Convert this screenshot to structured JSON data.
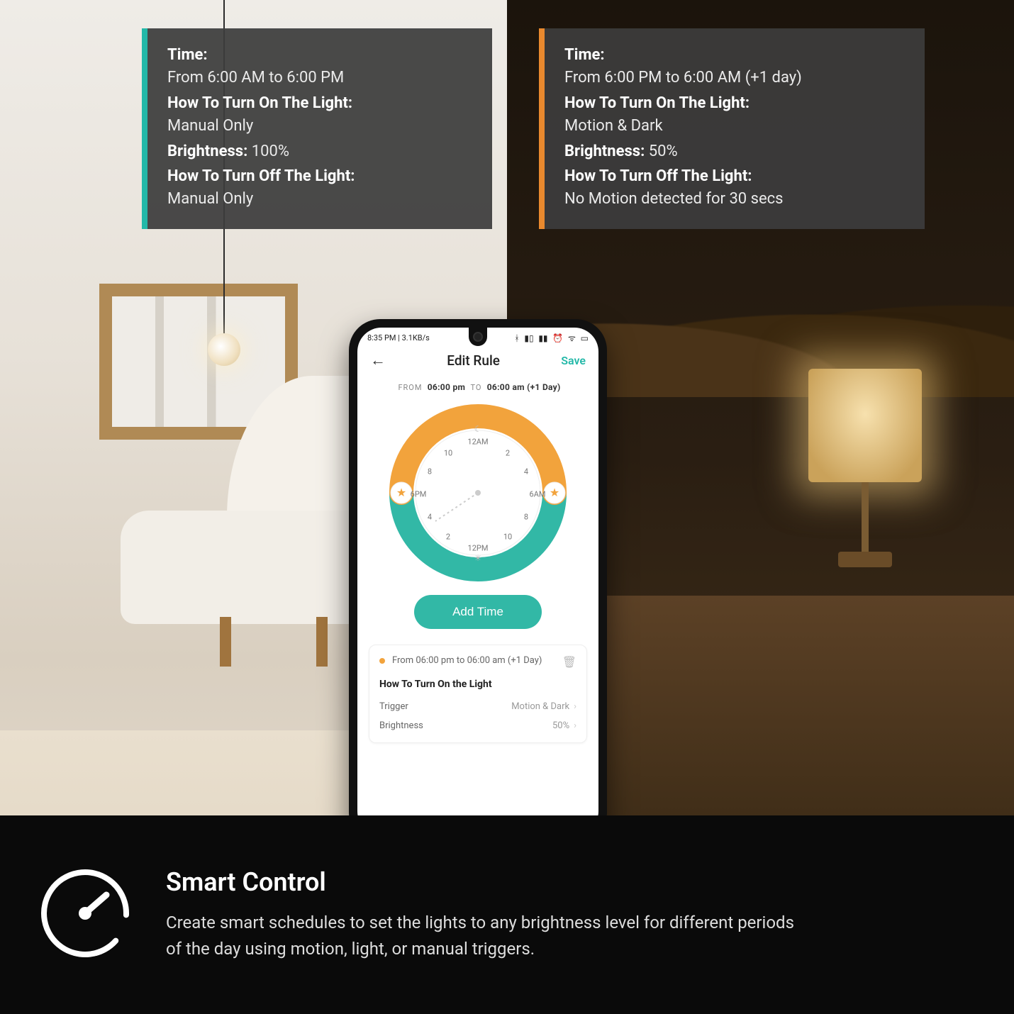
{
  "colors": {
    "teal": "#23b8a8",
    "orange": "#e9892e",
    "accent_btn": "#32b8a6"
  },
  "cards": {
    "left": {
      "time_label": "Time:",
      "time_value": "From 6:00 AM to 6:00 PM",
      "on_label": "How To Turn On The Light:",
      "on_value": "Manual Only",
      "brightness_label": "Brightness:",
      "brightness_value": "100%",
      "off_label": "How To Turn Off The Light:",
      "off_value": "Manual Only"
    },
    "right": {
      "time_label": "Time:",
      "time_value": "From 6:00 PM to 6:00 AM (+1 day)",
      "on_label": "How To Turn On The Light:",
      "on_value": "Motion & Dark",
      "brightness_label": "Brightness:",
      "brightness_value": "50%",
      "off_label": "How To Turn Off The Light:",
      "off_value": "No Motion detected for 30 secs"
    }
  },
  "phone": {
    "status_left": "8:35 PM | 3.1KB/s",
    "status_icons": [
      "bt",
      "sig1",
      "sig2",
      "alarm",
      "wifi",
      "batt"
    ],
    "back_glyph": "←",
    "title": "Edit Rule",
    "save": "Save",
    "from_lbl": "FROM",
    "to_lbl": "TO",
    "from_time": "06:00 pm",
    "to_time": "06:00 am (+1 Day)",
    "dial": {
      "labels": {
        "top": "12AM",
        "right": "6AM",
        "bottom": "12PM",
        "left": "6PM"
      },
      "ticks": [
        "2",
        "4",
        "8",
        "10",
        "2",
        "4",
        "8",
        "10"
      ]
    },
    "add_time": "Add Time",
    "rule": {
      "range": "From 06:00 pm to 06:00 am (+1 Day)",
      "section": "How To Turn On the Light",
      "rows": [
        {
          "label": "Trigger",
          "value": "Motion & Dark"
        },
        {
          "label": "Brightness",
          "value": "50%"
        }
      ]
    }
  },
  "footer": {
    "title": "Smart Control",
    "body": "Create smart schedules to set the lights to any brightness level for different periods of the day using motion, light, or manual triggers."
  }
}
